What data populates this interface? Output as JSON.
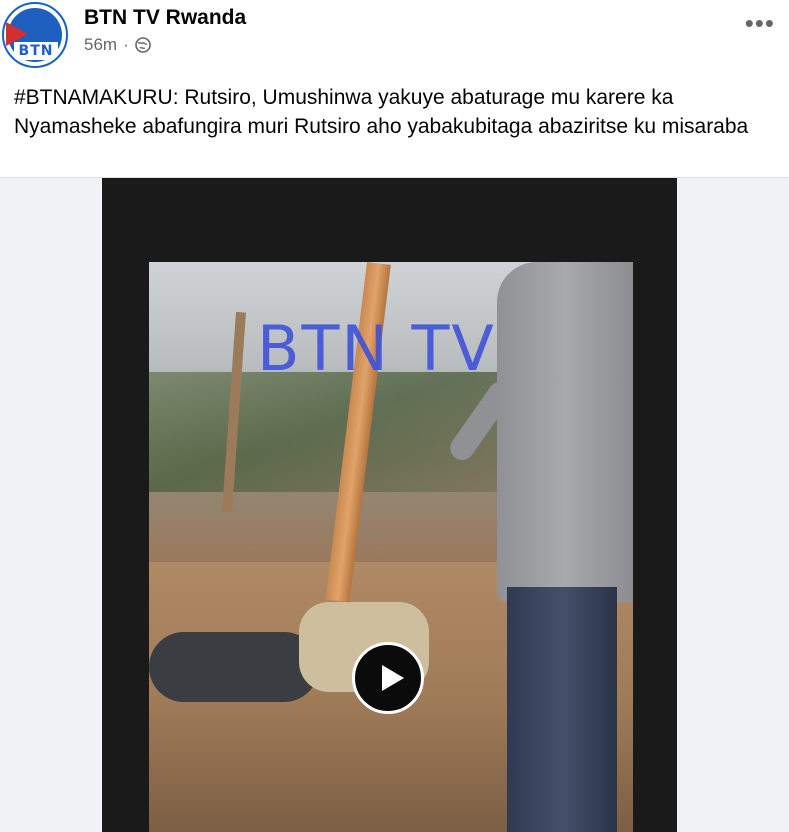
{
  "post": {
    "page_name": "BTN TV Rwanda",
    "time": "56m",
    "separator": "·",
    "privacy_icon": "globe-icon",
    "more_label": "•••",
    "caption": "#BTNAMAKURU: Rutsiro, Umushinwa yakuye abaturage mu karere ka Nyamasheke abafungira muri Rutsiro aho yabakubitaga abaziritse ku misaraba",
    "avatar_text": "BTN"
  },
  "video": {
    "watermark": "BTN TV",
    "play_icon": "play-icon"
  }
}
